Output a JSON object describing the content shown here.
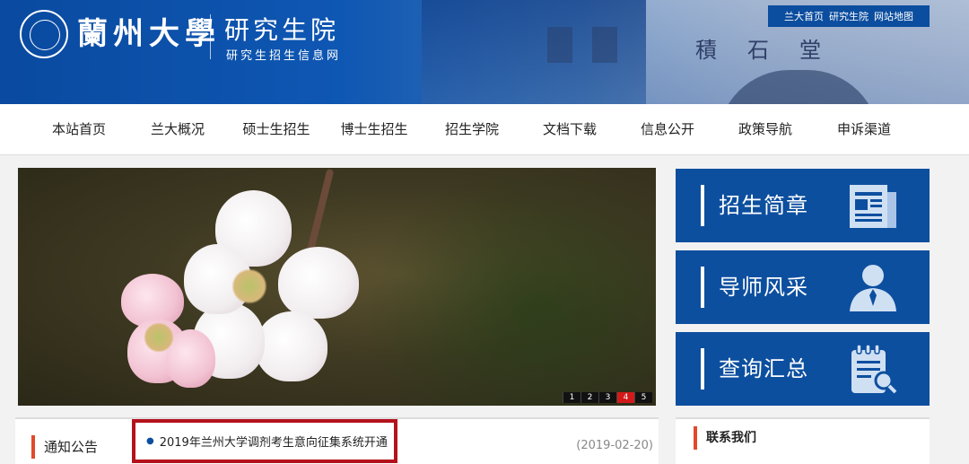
{
  "header": {
    "university_name": "蘭州大學",
    "site_name": "研究生院",
    "site_subtitle": "研究生招生信息网",
    "building_sign": "積石堂",
    "top_links": [
      "兰大首页",
      "研究生院",
      "网站地图"
    ]
  },
  "nav": {
    "items": [
      "本站首页",
      "兰大概况",
      "硕士生招生",
      "博士生招生",
      "招生学院",
      "文档下载",
      "信息公开",
      "政策导航",
      "申诉渠道"
    ]
  },
  "slider": {
    "pages": [
      "1",
      "2",
      "3",
      "4",
      "5"
    ],
    "active_page": "4"
  },
  "tiles": [
    {
      "label": "招生简章",
      "icon": "newspaper-icon"
    },
    {
      "label": "导师风采",
      "icon": "person-icon"
    },
    {
      "label": "查询汇总",
      "icon": "clipboard-search-icon"
    }
  ],
  "notice": {
    "title": "通知公告",
    "item_text": "2019年兰州大学调剂考生意向征集系统开通",
    "item_date": "(2019-02-20)"
  },
  "contact": {
    "title": "联系我们"
  },
  "colors": {
    "brand_blue": "#0d4f9f",
    "highlight_red": "#b4121c",
    "accent_orange": "#e04a2a"
  }
}
